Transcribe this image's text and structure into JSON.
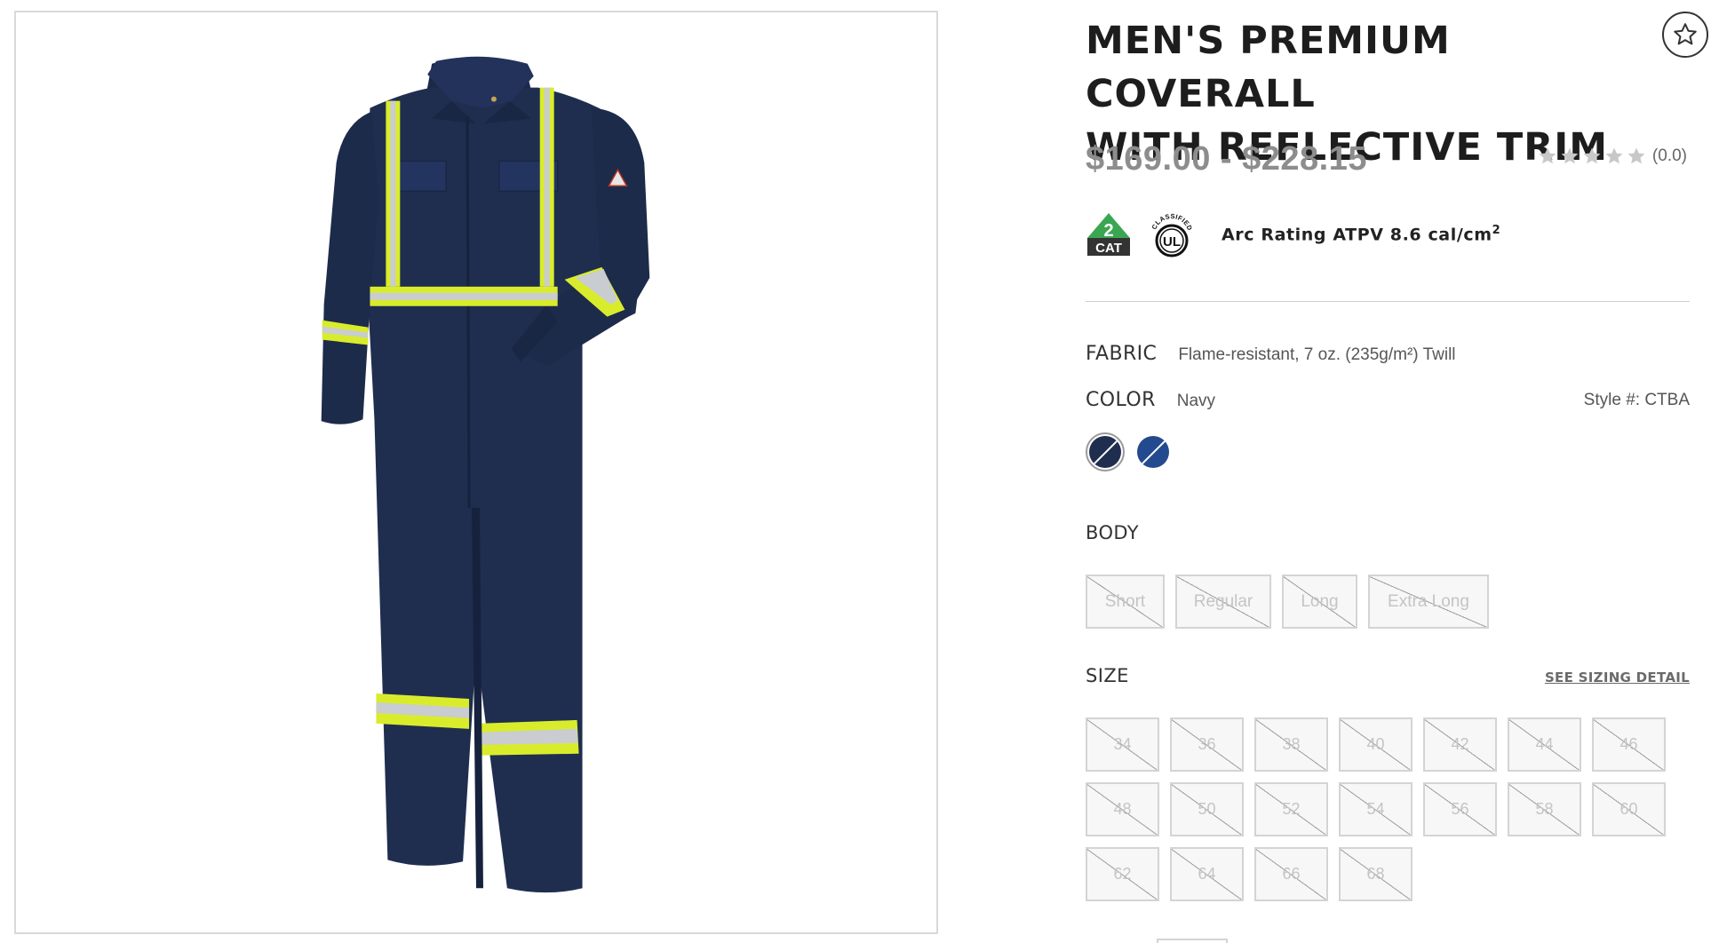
{
  "product": {
    "title_line1": "MEN'S PREMIUM COVERALL",
    "title_line2": "WITH REFLECTIVE TRIM",
    "price_range": "$169.00 - $228.15",
    "rating": {
      "value": "(0.0)",
      "stars": 5,
      "filled": 0
    },
    "badges": {
      "cat_number": "2",
      "cat_text": "CAT",
      "ul_top": "CLASSIFIED",
      "ul_mark": "UL",
      "arc_rating_text": "Arc Rating ATPV 8.6 cal/cm",
      "arc_rating_sup": "2"
    },
    "fabric": {
      "label": "FABRIC",
      "value": "Flame-resistant, 7 oz. (235g/m²) Twill"
    },
    "color": {
      "label": "COLOR",
      "value": "Navy"
    },
    "style_number": "Style #: CTBA",
    "swatches": [
      {
        "name": "Navy",
        "hex": "#1f2e4f",
        "selected": true
      },
      {
        "name": "Royal Blue",
        "hex": "#234a8f",
        "selected": false
      }
    ],
    "body": {
      "label": "BODY",
      "options": [
        "Short",
        "Regular",
        "Long",
        "Extra Long"
      ]
    },
    "size": {
      "label": "SIZE",
      "sizing_link": "SEE SIZING DETAIL",
      "options": [
        "34",
        "36",
        "38",
        "40",
        "42",
        "44",
        "46",
        "48",
        "50",
        "52",
        "54",
        "56",
        "58",
        "60",
        "62",
        "64",
        "66",
        "68"
      ]
    }
  },
  "colors": {
    "navy": "#1f2e4f",
    "reflective_yellow": "#d9ec2c",
    "reflective_silver": "#c9ccd0",
    "price_gray": "#8d8d8d"
  }
}
